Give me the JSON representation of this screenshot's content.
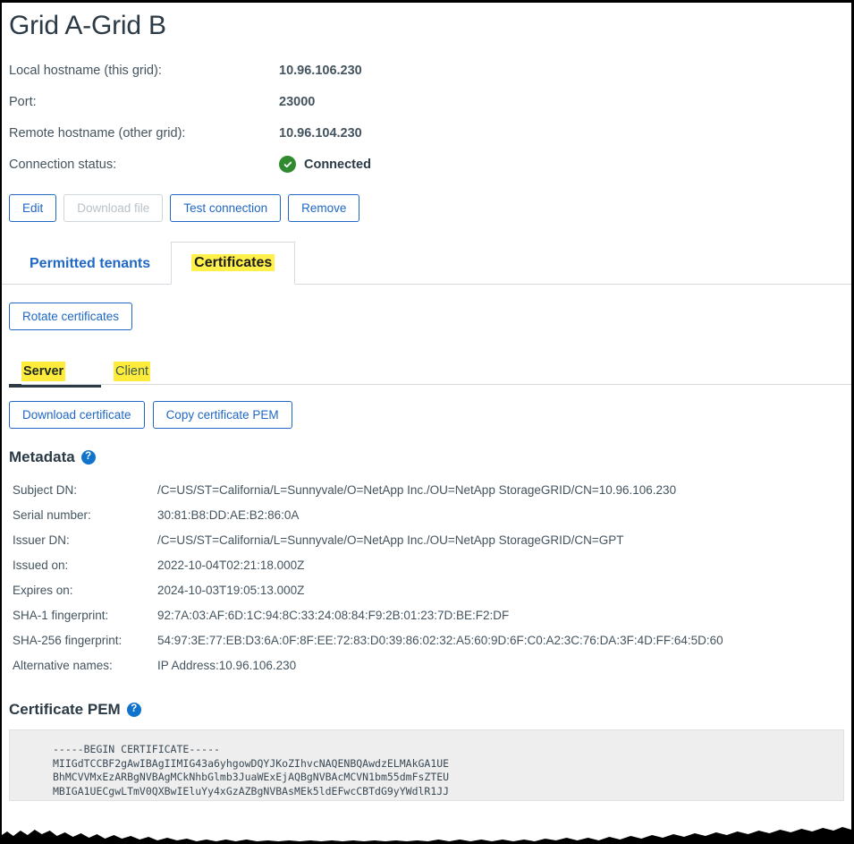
{
  "page": {
    "title": "Grid A-Grid B"
  },
  "info": {
    "rows": [
      {
        "label": "Local hostname (this grid):",
        "value": "10.96.106.230"
      },
      {
        "label": "Port:",
        "value": "23000"
      },
      {
        "label": "Remote hostname (other grid):",
        "value": "10.96.104.230"
      }
    ],
    "status_label": "Connection status:",
    "status_value": "Connected",
    "status_icon": "check-circle-icon",
    "status_color": "#308a30"
  },
  "actions": {
    "edit": "Edit",
    "download_file": "Download file",
    "test_connection": "Test connection",
    "remove": "Remove"
  },
  "tabs": {
    "permitted_tenants": "Permitted tenants",
    "certificates": "Certificates",
    "active": "Certificates"
  },
  "certificates": {
    "rotate_button": "Rotate certificates",
    "subtabs": {
      "server": "Server",
      "client": "Client",
      "active": "Server"
    },
    "download_certificate": "Download certificate",
    "copy_certificate_pem": "Copy certificate PEM"
  },
  "metadata": {
    "heading": "Metadata",
    "help_icon": "help-circle-icon",
    "rows": [
      {
        "key": "Subject DN:",
        "value": "/C=US/ST=California/L=Sunnyvale/O=NetApp Inc./OU=NetApp StorageGRID/CN=10.96.106.230"
      },
      {
        "key": "Serial number:",
        "value": "30:81:B8:DD:AE:B2:86:0A"
      },
      {
        "key": "Issuer DN:",
        "value": "/C=US/ST=California/L=Sunnyvale/O=NetApp Inc./OU=NetApp StorageGRID/CN=GPT"
      },
      {
        "key": "Issued on:",
        "value": "2022-10-04T02:21:18.000Z"
      },
      {
        "key": "Expires on:",
        "value": "2024-10-03T19:05:13.000Z"
      },
      {
        "key": "SHA-1 fingerprint:",
        "value": "92:7A:03:AF:6D:1C:94:8C:33:24:08:84:F9:2B:01:23:7D:BE:F2:DF"
      },
      {
        "key": "SHA-256 fingerprint:",
        "value": "54:97:3E:77:EB:D3:6A:0F:8F:EE:72:83:D0:39:86:02:32:A5:60:9D:6F:C0:A2:3C:76:DA:3F:4D:FF:64:5D:60"
      },
      {
        "key": "Alternative names:",
        "value": "IP Address:10.96.106.230"
      }
    ]
  },
  "certificate_pem": {
    "heading": "Certificate PEM",
    "help_icon": "help-circle-icon",
    "text": "-----BEGIN CERTIFICATE-----\nMIIGdTCCBF2gAwIBAgIIMIG43a6yhgowDQYJKoZIhvcNAQENBQAwdzELMAkGA1UE\nBhMCVVMxEzARBgNVBAgMCkNhbGlmb3JuaWExEjAQBgNVBAcMCVN1bm55dmFsZTEU\nMBIGA1UECgwLTmV0QXBwIEluYy4xGzAZBgNVBAsMEk5ldEFwcCBTdG9yYWdlR1JJ"
  },
  "colors": {
    "accent_blue": "#2068c4",
    "highlight_yellow": "#ffeb3b",
    "status_green": "#308a30",
    "help_blue": "#1174cc"
  }
}
